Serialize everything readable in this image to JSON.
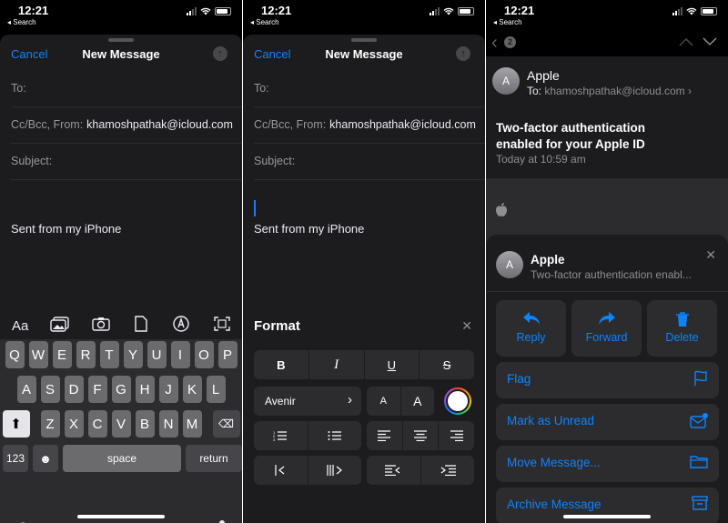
{
  "status": {
    "time": "12:21",
    "back": "◂ Search"
  },
  "compose": {
    "cancel": "Cancel",
    "title": "New Message",
    "to_label": "To:",
    "ccbcc_label": "Cc/Bcc, From:",
    "from_value": "khamoshpathak@icloud.com",
    "subject_label": "Subject:",
    "signature": "Sent from my iPhone"
  },
  "toolbar": {
    "aa": "Aa"
  },
  "keyboard": {
    "row1": [
      "Q",
      "W",
      "E",
      "R",
      "T",
      "Y",
      "U",
      "I",
      "O",
      "P"
    ],
    "row2": [
      "A",
      "S",
      "D",
      "F",
      "G",
      "H",
      "J",
      "K",
      "L"
    ],
    "row3": [
      "Z",
      "X",
      "C",
      "V",
      "B",
      "N",
      "M"
    ],
    "numbers": "123",
    "space": "space",
    "return": "return"
  },
  "format": {
    "title": "Format",
    "bold": "B",
    "italic": "I",
    "underline": "U",
    "strike": "S",
    "font": "Avenir",
    "size_small": "A",
    "size_large": "A"
  },
  "mail": {
    "badge": "2",
    "avatar_letter": "A",
    "sender": "Apple",
    "to_label": "To:",
    "to_value": "khamoshpathak@icloud.com",
    "subject": "Two-factor authentication enabled for your Apple ID",
    "date": "Today at 10:59 am",
    "sheet_sender": "Apple",
    "sheet_preview": "Two-factor authentication enabl...",
    "reply": "Reply",
    "forward": "Forward",
    "delete": "Delete",
    "flag": "Flag",
    "mark_unread": "Mark as Unread",
    "move": "Move Message...",
    "archive": "Archive Message"
  },
  "colors": {
    "accent": "#0a84ff"
  }
}
